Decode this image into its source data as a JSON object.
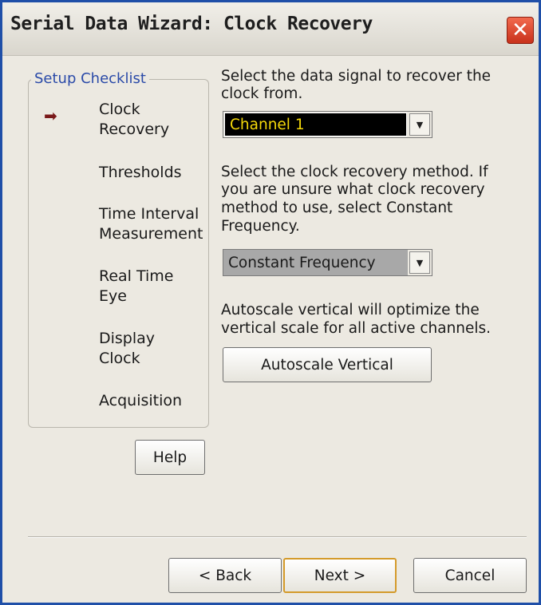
{
  "window": {
    "title": "Serial Data Wizard: Clock Recovery"
  },
  "checklist": {
    "legend": "Setup Checklist",
    "steps": [
      {
        "line1": "Clock",
        "line2": "Recovery"
      },
      {
        "line1": "Thresholds",
        "line2": ""
      },
      {
        "line1": "Time Interval",
        "line2": "Measurement"
      },
      {
        "line1": "Real Time",
        "line2": "Eye"
      },
      {
        "line1": "Display",
        "line2": "Clock"
      },
      {
        "line1": "Acquisition",
        "line2": ""
      }
    ]
  },
  "signal": {
    "prompt_line1": "Select the data signal to recover the",
    "prompt_line2": "clock from.",
    "selected": "Channel 1"
  },
  "method": {
    "prompt_line1": "Select the clock recovery method. If",
    "prompt_line2": "you are unsure what clock recovery",
    "prompt_line3": "method to use, select Constant",
    "prompt_line4": "Frequency.",
    "selected": "Constant Frequency"
  },
  "autoscale": {
    "note_line1": "Autoscale vertical will optimize the",
    "note_line2": "vertical scale for all active channels.",
    "button_label": "Autoscale Vertical"
  },
  "buttons": {
    "help": "Help",
    "back": "< Back",
    "next": "Next >",
    "cancel": "Cancel"
  },
  "colors": {
    "title_bar_border": "#1f4fa8",
    "close_button": "#d9412a",
    "legend_text": "#2a4aa8",
    "current_step_arrow": "#7a1a1a",
    "channel_select_bg": "#000000",
    "channel_select_text": "#f5d90a",
    "method_select_bg": "#a8a8a8",
    "default_button_border": "#d49a2a"
  }
}
